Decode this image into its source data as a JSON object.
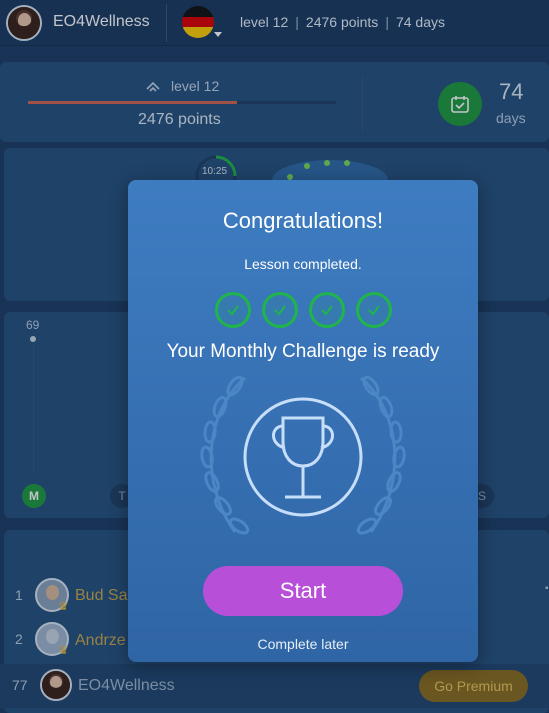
{
  "topbar": {
    "username": "EO4Wellness",
    "level": "level 12",
    "points": "2476 points",
    "days": "74 days",
    "separator": "|"
  },
  "progress_card": {
    "level": "level 12",
    "points": "2476 points",
    "level_progress_percent": 68,
    "days_value": "74",
    "days_label": "days"
  },
  "lesson_card": {
    "timer": "10:25"
  },
  "chart_card": {
    "peak_value": "69",
    "day_labels": [
      "M",
      "T",
      "S"
    ]
  },
  "leaderboard": {
    "rows": [
      {
        "rank": "1",
        "name": "Bud Sa"
      },
      {
        "rank": "2",
        "name": "Andrze"
      }
    ],
    "self": {
      "rank": "77",
      "name": "EO4Wellness"
    },
    "premium_label": "Go Premium"
  },
  "modal": {
    "title": "Congratulations!",
    "subtitle": "Lesson completed.",
    "completed_checks": 4,
    "challenge_text": "Your Monthly Challenge is ready",
    "start_label": "Start",
    "later_label": "Complete later"
  },
  "colors": {
    "background": "#1d3c63",
    "card": "#26507d",
    "accent_green": "#1f9a3d",
    "start_button": "#b84fd8",
    "premium_button": "#8a6b1e",
    "progress_fill": "#d4654f"
  }
}
